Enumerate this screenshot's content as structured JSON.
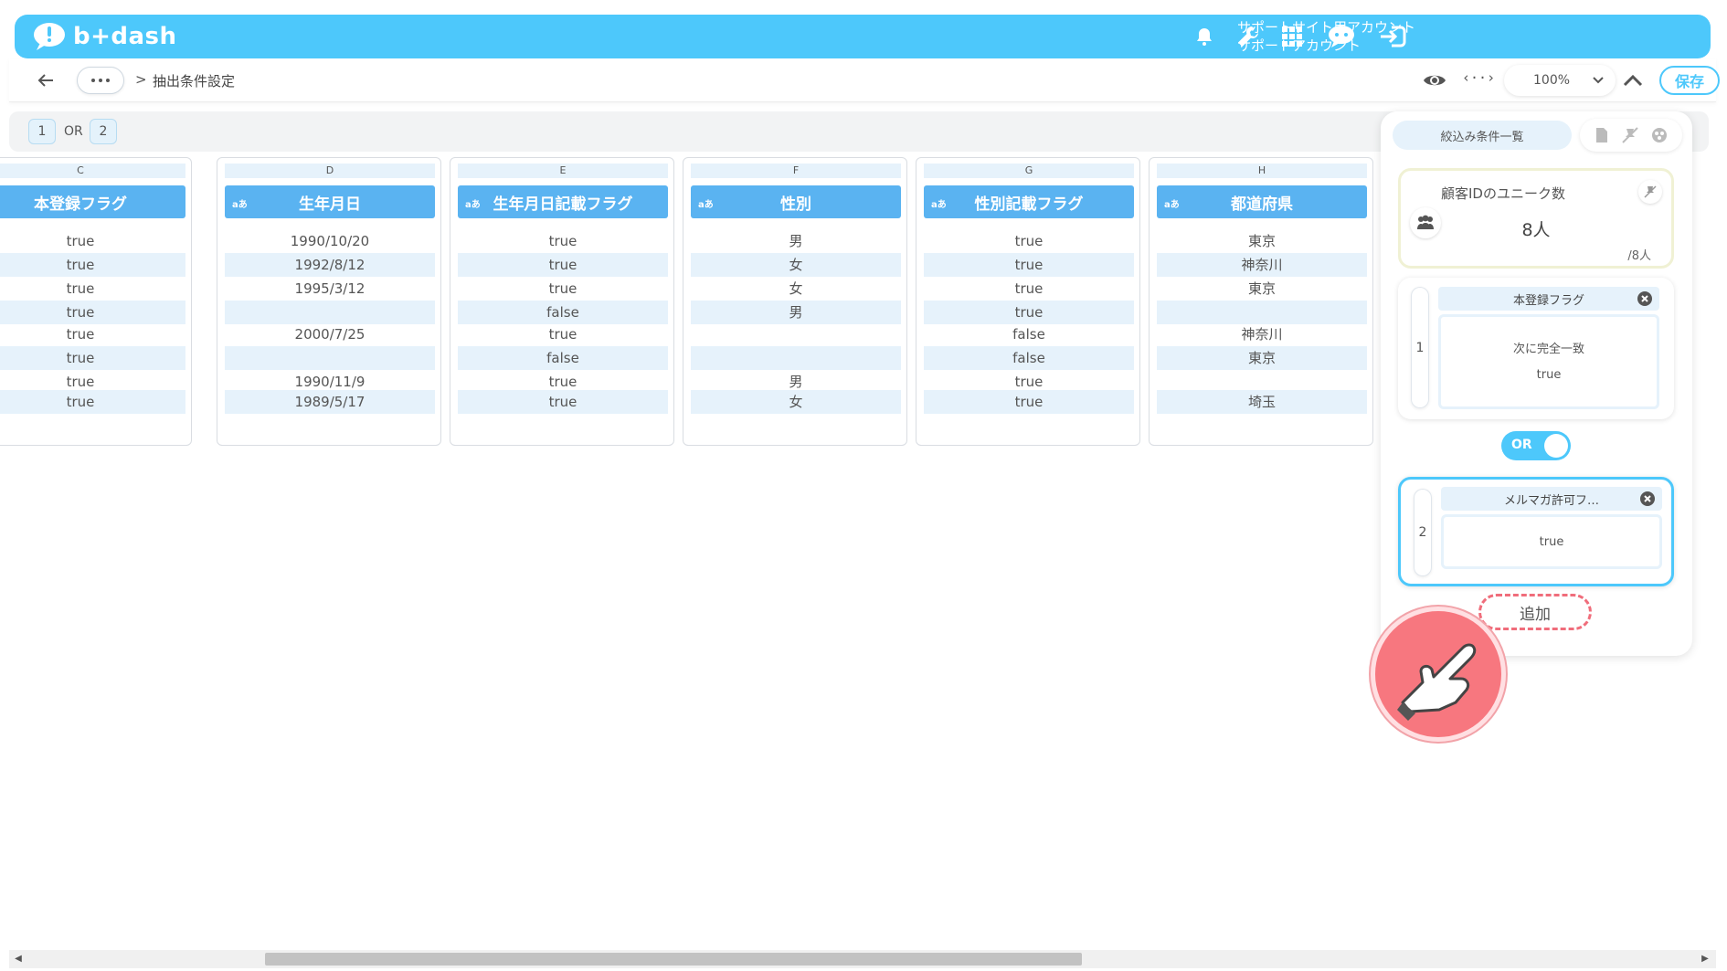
{
  "header": {
    "logo_text": "b+dash",
    "account_line1": "サポートサイト用アカウント",
    "account_line2": "サポートアカウント",
    "icons": [
      "bell-icon",
      "wrench-icon",
      "grid-icon",
      "chat-icon",
      "logout-icon"
    ],
    "bg_color": "#4dc8fb"
  },
  "toolbar": {
    "breadcrumb_sep": ">",
    "breadcrumb_current": "抽出条件設定",
    "zoom": "100%",
    "save_label": "保存"
  },
  "condition_bar": {
    "chip1": "1",
    "op": "OR",
    "chip2": "2"
  },
  "columns": [
    {
      "letter": "C",
      "title": "本登録フラグ",
      "type_badge": "",
      "cells": [
        "true",
        "true",
        "true",
        "true",
        "true",
        "true",
        "true",
        "true"
      ]
    },
    {
      "letter": "D",
      "title": "生年月日",
      "type_badge": "aあ",
      "cells": [
        "1990/10/20",
        "1992/8/12",
        "1995/3/12",
        "",
        "2000/7/25",
        "",
        "1990/11/9",
        "1989/5/17"
      ]
    },
    {
      "letter": "E",
      "title": "生年月日記載フラグ",
      "type_badge": "aあ",
      "cells": [
        "true",
        "true",
        "true",
        "false",
        "true",
        "false",
        "true",
        "true"
      ]
    },
    {
      "letter": "F",
      "title": "性別",
      "type_badge": "aあ",
      "cells": [
        "男",
        "女",
        "女",
        "男",
        "",
        "",
        "男",
        "女"
      ]
    },
    {
      "letter": "G",
      "title": "性別記載フラグ",
      "type_badge": "aあ",
      "cells": [
        "true",
        "true",
        "true",
        "true",
        "false",
        "false",
        "true",
        "true"
      ]
    },
    {
      "letter": "H",
      "title": "都道府県",
      "type_badge": "aあ",
      "cells": [
        "東京",
        "神奈川",
        "東京",
        "",
        "神奈川",
        "東京",
        "",
        "埼玉"
      ]
    }
  ],
  "panel": {
    "tab_label": "絞込み条件一覧",
    "count_title": "顧客IDのユニーク数",
    "count_value": "8人",
    "count_total": "/8人",
    "conditions": [
      {
        "index": "1",
        "field": "本登録フラグ",
        "operator": "次に完全一致",
        "value": "true"
      },
      {
        "index": "2",
        "field": "メルマガ許可フ…",
        "value": "true"
      }
    ],
    "toggle_label": "OR",
    "add_label": "追加"
  }
}
